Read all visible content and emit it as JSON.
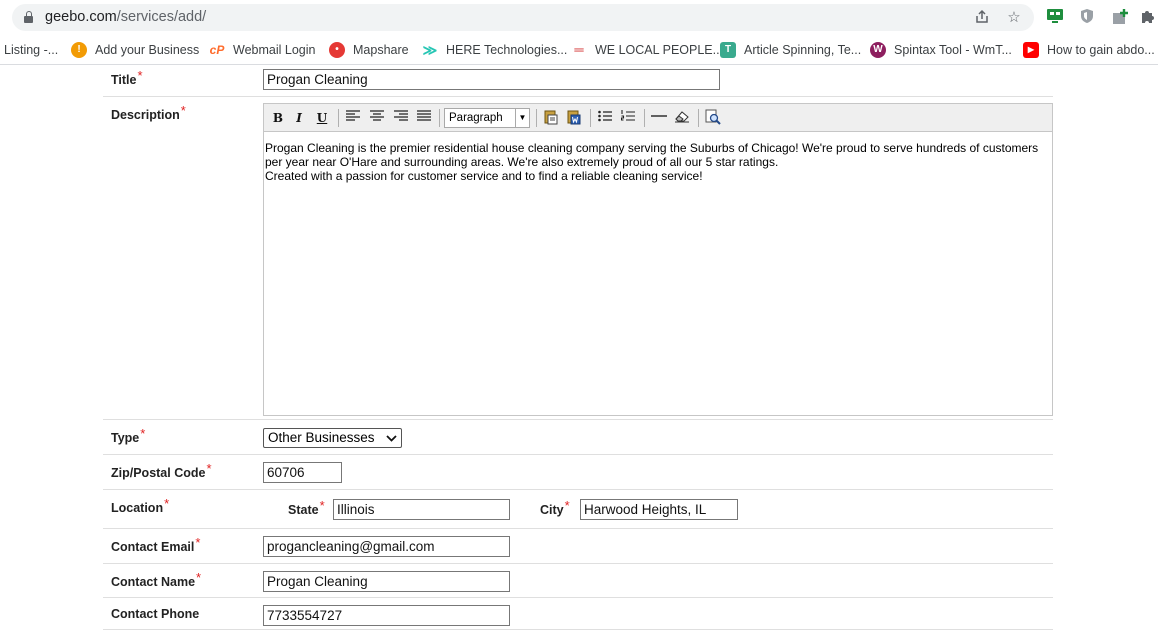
{
  "browser": {
    "url_domain": "geebo.com",
    "url_path": "/services/add/",
    "bookmarks": [
      {
        "label": "Listing -...",
        "icon": "page-icon",
        "color": "#888888"
      },
      {
        "label": "Add your Business",
        "icon": "google-business-icon",
        "color": "#f29b05"
      },
      {
        "label": "Webmail Login",
        "icon": "cpanel-icon",
        "color": "#ff6c2c"
      },
      {
        "label": "Mapshare",
        "icon": "mapshare-icon",
        "color": "#e53935"
      },
      {
        "label": "HERE Technologies...",
        "icon": "here-icon",
        "color": "#26c6b4"
      },
      {
        "label": "WE LOCAL PEOPLE...",
        "icon": "welocal-icon",
        "color": "#d32f2f"
      },
      {
        "label": "Article Spinning, Te...",
        "icon": "article-icon",
        "color": "#3aaa8e"
      },
      {
        "label": "Spintax Tool - WmT...",
        "icon": "spintax-icon",
        "color": "#8e1f5f"
      },
      {
        "label": "How to gain abdo...",
        "icon": "youtube-icon",
        "color": "#ff0000"
      }
    ]
  },
  "form": {
    "title": {
      "label": "Title",
      "value": "Progan Cleaning"
    },
    "description": {
      "label": "Description",
      "format_value": "Paragraph",
      "line1": "Progan Cleaning is the premier residential house cleaning company serving the Suburbs of Chicago! We're proud to serve hundreds of customers",
      "line2": "per year near O'Hare and surrounding areas. We're also extremely proud of all our 5 star ratings.",
      "line3": "Created with a passion for customer service and to find a reliable cleaning service!"
    },
    "type": {
      "label": "Type",
      "value": "Other Businesses"
    },
    "zip": {
      "label": "Zip/Postal Code",
      "value": "60706"
    },
    "location": {
      "label": "Location",
      "state_label": "State",
      "state_value": "Illinois",
      "city_label": "City",
      "city_value": "Harwood Heights, IL"
    },
    "contact_email": {
      "label": "Contact Email",
      "value": "progancleaning@gmail.com"
    },
    "contact_name": {
      "label": "Contact Name",
      "value": "Progan Cleaning"
    },
    "contact_phone": {
      "label": "Contact Phone",
      "value": "7733554727"
    },
    "required_mark": "*"
  }
}
